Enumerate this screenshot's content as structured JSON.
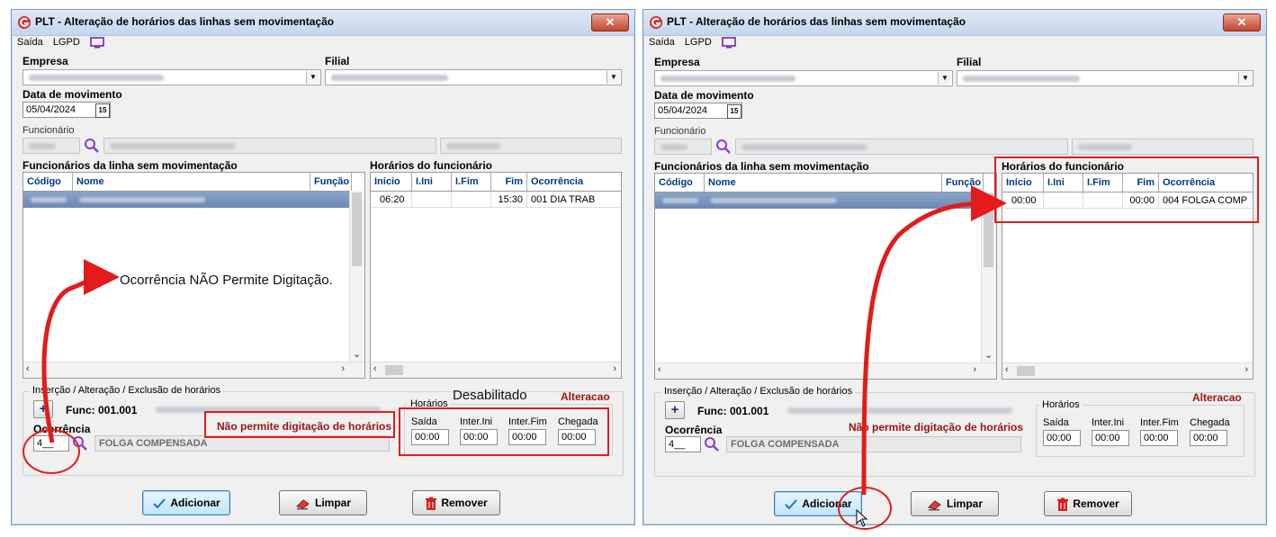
{
  "windows": [
    {
      "title": "PLT - Alteração de horários das linhas sem movimentação",
      "menu": [
        "Saída",
        "LGPD"
      ],
      "empresa_label": "Empresa",
      "filial_label": "Filial",
      "data_label": "Data de movimento",
      "data_value": "05/04/2024",
      "funcionario_label": "Funcionário",
      "left_list_title": "Funcionários da linha sem movimentação",
      "left_cols": [
        "Código",
        "Nome",
        "Função"
      ],
      "right_list_title": "Horários do funcionário",
      "right_cols": [
        "Início",
        "I.Ini",
        "I.Fim",
        "Fim",
        "Ocorrência"
      ],
      "schedule_row": {
        "inicio": "06:20",
        "iini": "",
        "ifim": "",
        "fim": "15:30",
        "ocorrencia": "001 DIA TRAB"
      },
      "group_title": "Inserção / Alteração / Exclusão de horários",
      "mode_label": "Alteracao",
      "func_text": "Func: 001.001",
      "warning": "Não permite digitação de horários",
      "ocorrencia_label": "Ocorrência",
      "ocorrencia_value": "4__",
      "ocorrencia_desc": "FOLGA COMPENSADA",
      "horarios_label": "Horários",
      "time_labels": [
        "Saída",
        "Inter.Ini",
        "Inter.Fim",
        "Chegada"
      ],
      "time_values": [
        "00:00",
        "00:00",
        "00:00",
        "00:00"
      ],
      "buttons": [
        "Adicionar",
        "Limpar",
        "Remover"
      ]
    },
    {
      "title": "PLT - Alteração de horários das linhas sem movimentação",
      "menu": [
        "Saída",
        "LGPD"
      ],
      "empresa_label": "Empresa",
      "filial_label": "Filial",
      "data_label": "Data de movimento",
      "data_value": "05/04/2024",
      "funcionario_label": "Funcionário",
      "left_list_title": "Funcionários da linha sem movimentação",
      "left_cols": [
        "Código",
        "Nome",
        "Função"
      ],
      "right_list_title": "Horários do funcionário",
      "right_cols": [
        "Início",
        "I.Ini",
        "I.Fim",
        "Fim",
        "Ocorrência"
      ],
      "schedule_row": {
        "inicio": "00:00",
        "iini": "",
        "ifim": "",
        "fim": "00:00",
        "ocorrencia": "004 FOLGA COMP"
      },
      "group_title": "Inserção / Alteração / Exclusão de horários",
      "mode_label": "Alteracao",
      "func_text": "Func: 001.001",
      "warning": "Não permite digitação de horários",
      "ocorrencia_label": "Ocorrência",
      "ocorrencia_value": "4__",
      "ocorrencia_desc": "FOLGA COMPENSADA",
      "horarios_label": "Horários",
      "time_labels": [
        "Saída",
        "Inter.Ini",
        "Inter.Fim",
        "Chegada"
      ],
      "time_values": [
        "00:00",
        "00:00",
        "00:00",
        "00:00"
      ],
      "buttons": [
        "Adicionar",
        "Limpar",
        "Remover"
      ]
    }
  ],
  "annotations": {
    "ocorrencia_note": "Ocorrência NÃO Permite Digitação.",
    "disabled_note": "Desabilitado"
  },
  "colors": {
    "highlight": "#e11d1d",
    "warning_text": "#9c1313",
    "header_text": "#003a82"
  }
}
